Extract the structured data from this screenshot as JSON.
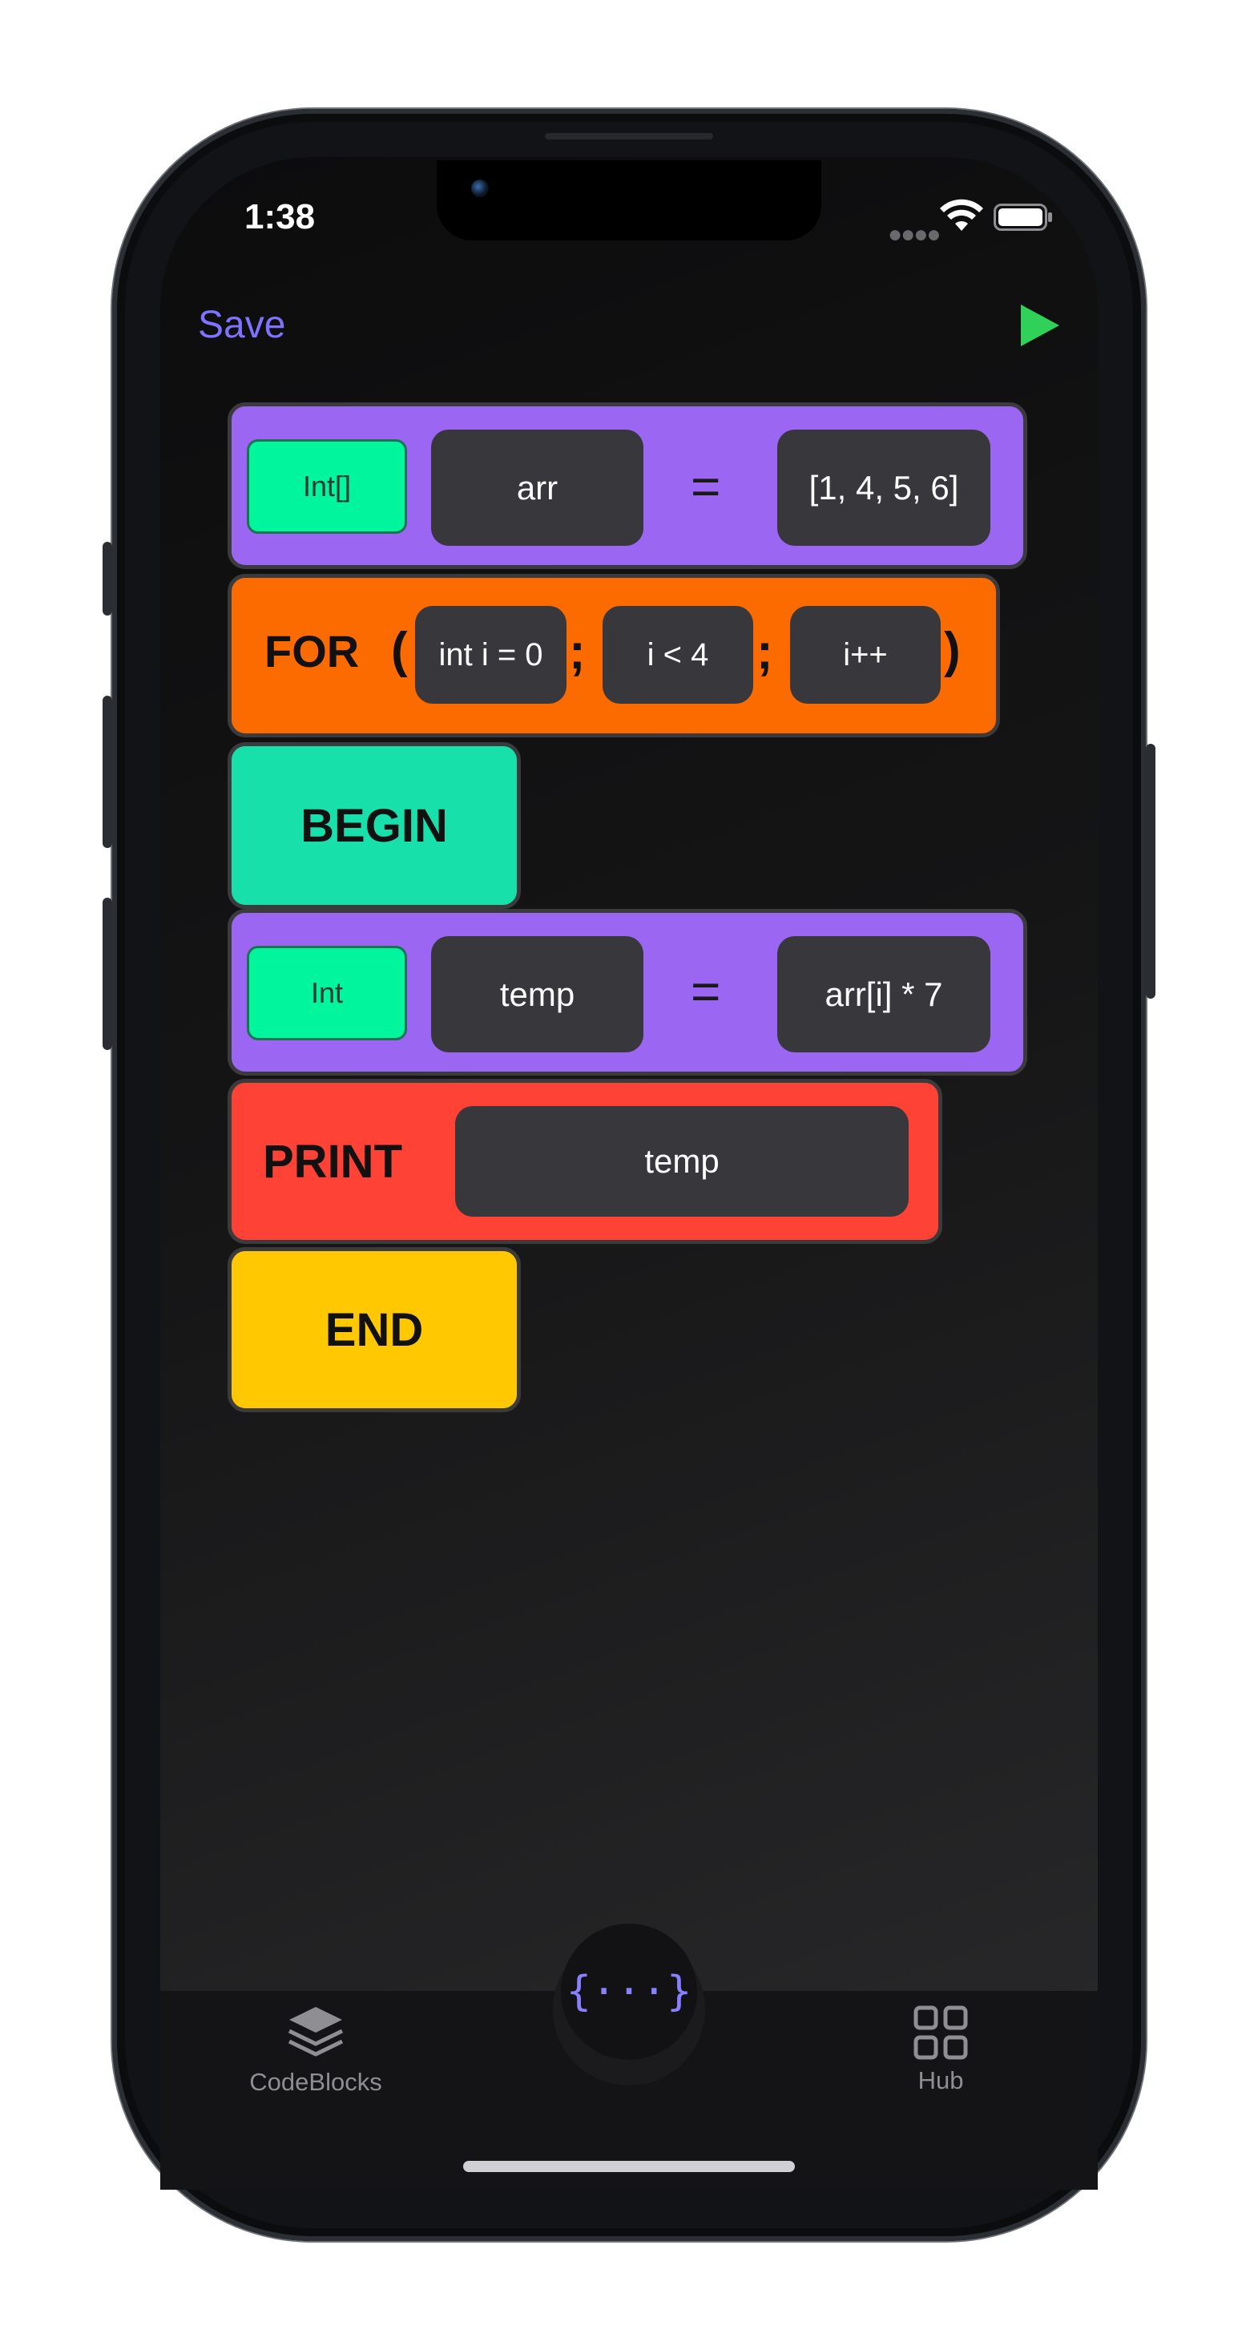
{
  "status": {
    "time": "1:38"
  },
  "toolbar": {
    "save_label": "Save"
  },
  "blocks": {
    "arr_decl": {
      "type": "Int[]",
      "name": "arr",
      "op": "=",
      "value": "[1, 4, 5, 6]"
    },
    "for_loop": {
      "keyword": "FOR",
      "open": "(",
      "init": "int i = 0",
      "sep1": ";",
      "cond": "i < 4",
      "sep2": ";",
      "step": "i++",
      "close": ")"
    },
    "begin": {
      "keyword": "BEGIN"
    },
    "temp_decl": {
      "type": "Int",
      "name": "temp",
      "op": "=",
      "value": "arr[i] * 7"
    },
    "print": {
      "keyword": "PRINT",
      "arg": "temp"
    },
    "end": {
      "keyword": "END"
    }
  },
  "tabbar": {
    "left": {
      "label": "CodeBlocks",
      "icon": "stack-layers-icon"
    },
    "center": {
      "icon": "braces-icon",
      "glyph": "{···}"
    },
    "right": {
      "label": "Hub",
      "icon": "grid-icon"
    }
  },
  "colors": {
    "accent": "#7f72ff",
    "run": "#30d158",
    "assign_block": "#9a66f2",
    "for_block": "#fc6b00",
    "begin_block": "#17e0ab",
    "print_block": "#ff4236",
    "end_block": "#ffc800",
    "type_chip": "#00f59c",
    "slot": "#38373c"
  }
}
